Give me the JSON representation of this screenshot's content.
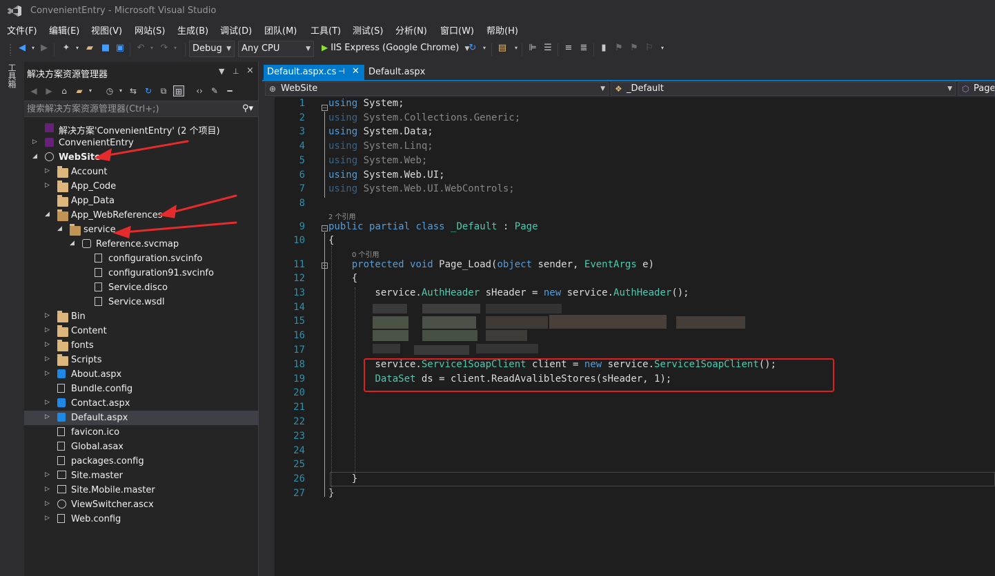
{
  "window": {
    "title": "ConvenientEntry - Microsoft Visual Studio"
  },
  "menu": [
    "文件(F)",
    "编辑(E)",
    "视图(V)",
    "网站(S)",
    "生成(B)",
    "调试(D)",
    "团队(M)",
    "工具(T)",
    "测试(S)",
    "分析(N)",
    "窗口(W)",
    "帮助(H)"
  ],
  "toolbar": {
    "config": "Debug",
    "platform": "Any CPU",
    "run_target": "IIS Express (Google Chrome)"
  },
  "toolbox": {
    "label": "工具箱"
  },
  "solution_explorer": {
    "title": "解决方案资源管理器",
    "search_placeholder": "搜索解决方案资源管理器(Ctrl+;)",
    "items": [
      {
        "label": "解决方案'ConvenientEntry' (2 个项目)",
        "level": 0,
        "icon": "solution-icon",
        "expander": ""
      },
      {
        "label": "ConvenientEntry",
        "level": 0,
        "icon": "csharp-project-icon",
        "expander": "collapsed"
      },
      {
        "label": "WebSite",
        "level": 0,
        "icon": "website-globe-icon",
        "expander": "expanded",
        "bold": true
      },
      {
        "label": "Account",
        "level": 1,
        "icon": "folder-icon",
        "expander": "collapsed"
      },
      {
        "label": "App_Code",
        "level": 1,
        "icon": "folder-icon",
        "expander": "collapsed"
      },
      {
        "label": "App_Data",
        "level": 1,
        "icon": "folder-icon",
        "expander": ""
      },
      {
        "label": "App_WebReferences",
        "level": 1,
        "icon": "folder-open-icon",
        "expander": "expanded"
      },
      {
        "label": "service",
        "level": 2,
        "icon": "folder-open-icon",
        "expander": "expanded"
      },
      {
        "label": "Reference.svcmap",
        "level": 3,
        "icon": "service-reference-icon",
        "expander": "expanded"
      },
      {
        "label": "configuration.svcinfo",
        "level": 4,
        "icon": "file-icon",
        "expander": ""
      },
      {
        "label": "configuration91.svcinfo",
        "level": 4,
        "icon": "file-icon",
        "expander": ""
      },
      {
        "label": "Service.disco",
        "level": 4,
        "icon": "file-icon",
        "expander": ""
      },
      {
        "label": "Service.wsdl",
        "level": 4,
        "icon": "file-icon",
        "expander": ""
      },
      {
        "label": "Bin",
        "level": 1,
        "icon": "folder-icon",
        "expander": "collapsed"
      },
      {
        "label": "Content",
        "level": 1,
        "icon": "folder-icon",
        "expander": "collapsed"
      },
      {
        "label": "fonts",
        "level": 1,
        "icon": "folder-icon",
        "expander": "collapsed"
      },
      {
        "label": "Scripts",
        "level": 1,
        "icon": "folder-icon",
        "expander": "collapsed"
      },
      {
        "label": "About.aspx",
        "level": 1,
        "icon": "aspx-file-icon",
        "expander": "collapsed"
      },
      {
        "label": "Bundle.config",
        "level": 1,
        "icon": "config-file-icon",
        "expander": ""
      },
      {
        "label": "Contact.aspx",
        "level": 1,
        "icon": "aspx-file-icon",
        "expander": "collapsed"
      },
      {
        "label": "Default.aspx",
        "level": 1,
        "icon": "aspx-file-icon",
        "expander": "collapsed",
        "selected": true
      },
      {
        "label": "favicon.ico",
        "level": 1,
        "icon": "file-icon",
        "expander": ""
      },
      {
        "label": "Global.asax",
        "level": 1,
        "icon": "file-icon",
        "expander": ""
      },
      {
        "label": "packages.config",
        "level": 1,
        "icon": "config-file-icon",
        "expander": ""
      },
      {
        "label": "Site.master",
        "level": 1,
        "icon": "master-page-icon",
        "expander": "collapsed"
      },
      {
        "label": "Site.Mobile.master",
        "level": 1,
        "icon": "master-page-icon",
        "expander": "collapsed"
      },
      {
        "label": "ViewSwitcher.ascx",
        "level": 1,
        "icon": "user-control-icon",
        "expander": "collapsed"
      },
      {
        "label": "Web.config",
        "level": 1,
        "icon": "config-file-icon",
        "expander": "collapsed"
      }
    ]
  },
  "editor": {
    "tabs": [
      {
        "label": "Default.aspx.cs",
        "active": true
      },
      {
        "label": "Default.aspx",
        "active": false
      }
    ],
    "nav": {
      "project": "WebSite",
      "class": "_Default",
      "member": "Page_"
    },
    "codelens": {
      "class_refs": "2 个引用",
      "method_refs": "0 个引用"
    },
    "lines": [
      {
        "n": "1",
        "tokens": [
          [
            "kw",
            "using"
          ],
          [
            "",
            ""
          ],
          [
            "",
            " System;"
          ]
        ]
      },
      {
        "n": "2",
        "dim": true,
        "tokens": [
          [
            "kw",
            "using"
          ],
          [
            "",
            " System.Collections.Generic;"
          ]
        ]
      },
      {
        "n": "3",
        "tokens": [
          [
            "kw",
            "using"
          ],
          [
            "",
            " System.Data;"
          ]
        ]
      },
      {
        "n": "4",
        "dim": true,
        "tokens": [
          [
            "kw",
            "using"
          ],
          [
            "",
            " System.Linq;"
          ]
        ]
      },
      {
        "n": "5",
        "dim": true,
        "tokens": [
          [
            "kw",
            "using"
          ],
          [
            "",
            " System.Web;"
          ]
        ]
      },
      {
        "n": "6",
        "tokens": [
          [
            "kw",
            "using"
          ],
          [
            "",
            " System.Web.UI;"
          ]
        ]
      },
      {
        "n": "7",
        "dim": true,
        "tokens": [
          [
            "kw",
            "using"
          ],
          [
            "",
            " System.Web.UI.WebControls;"
          ]
        ]
      },
      {
        "n": "8",
        "tokens": []
      },
      {
        "n": "9",
        "tokens": [
          [
            "kw",
            "public"
          ],
          [
            "",
            " "
          ],
          [
            "kw",
            "partial"
          ],
          [
            "",
            " "
          ],
          [
            "kw",
            "class"
          ],
          [
            "",
            " "
          ],
          [
            "ty",
            "_Default"
          ],
          [
            "",
            " : "
          ],
          [
            "ty",
            "Page"
          ]
        ]
      },
      {
        "n": "10",
        "tokens": [
          [
            "",
            "{"
          ]
        ]
      },
      {
        "n": "11",
        "tokens": [
          [
            "",
            "    "
          ],
          [
            "kw",
            "protected"
          ],
          [
            "",
            " "
          ],
          [
            "kw",
            "void"
          ],
          [
            "",
            " Page_Load("
          ],
          [
            "kw",
            "object"
          ],
          [
            "",
            " sender, "
          ],
          [
            "ty",
            "EventArgs"
          ],
          [
            "",
            " e)"
          ]
        ]
      },
      {
        "n": "12",
        "tokens": [
          [
            "",
            "    {"
          ]
        ]
      },
      {
        "n": "13",
        "tokens": [
          [
            "",
            "        service."
          ],
          [
            "ty",
            "AuthHeader"
          ],
          [
            "",
            " sHeader = "
          ],
          [
            "kw",
            "new"
          ],
          [
            "",
            " service."
          ],
          [
            "ty",
            "AuthHeader"
          ],
          [
            "",
            "();"
          ]
        ]
      },
      {
        "n": "14",
        "tokens": []
      },
      {
        "n": "15",
        "tokens": []
      },
      {
        "n": "16",
        "tokens": []
      },
      {
        "n": "17",
        "tokens": []
      },
      {
        "n": "18",
        "tokens": [
          [
            "",
            "        service."
          ],
          [
            "ty",
            "Service1SoapClient"
          ],
          [
            "",
            " client = "
          ],
          [
            "kw",
            "new"
          ],
          [
            "",
            " service."
          ],
          [
            "ty",
            "Service1SoapClient"
          ],
          [
            "",
            "();"
          ]
        ]
      },
      {
        "n": "19",
        "tokens": [
          [
            "",
            "        "
          ],
          [
            "ty",
            "DataSet"
          ],
          [
            "",
            " ds = client.ReadAvalibleStores(sHeader, 1);"
          ]
        ]
      },
      {
        "n": "20",
        "tokens": []
      },
      {
        "n": "21",
        "tokens": []
      },
      {
        "n": "22",
        "tokens": []
      },
      {
        "n": "23",
        "tokens": []
      },
      {
        "n": "24",
        "tokens": []
      },
      {
        "n": "25",
        "tokens": []
      },
      {
        "n": "26",
        "tokens": [
          [
            "",
            "    }"
          ]
        ]
      },
      {
        "n": "27",
        "tokens": [
          [
            "",
            "}"
          ]
        ]
      }
    ]
  },
  "colors": {
    "accent": "#007acc",
    "keyword": "#569cd6",
    "type": "#4ec9b0",
    "line_number": "#2b91af",
    "annotation": "#e02020"
  }
}
